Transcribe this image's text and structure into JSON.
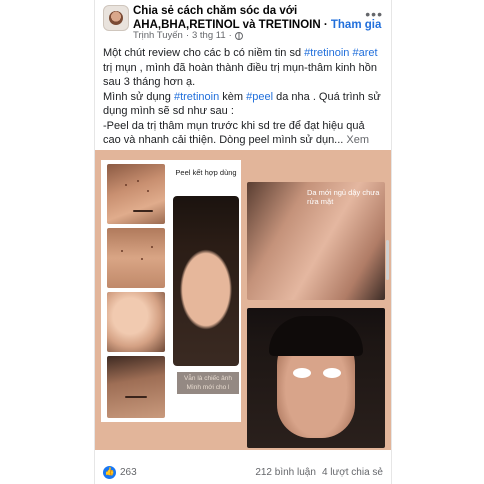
{
  "header": {
    "group_title": "Chia sẻ cách chăm sóc da với AHA,BHA,RETINOL và TRETINOIN",
    "separator": " · ",
    "join_label": "Tham gia",
    "author": "Trịnh Tuyến",
    "date": "3 thg 11",
    "more_icon": "more-options-icon",
    "privacy_icon": "globe-icon"
  },
  "post": {
    "line1_prefix": "Một chút review cho các b có niềm tin sd ",
    "tag_tretinoin": "#tretinoin",
    "tag_aret": "#aret",
    "line1_suffix": " trị mụn , mình đã hoàn thành điều trị mụn-thâm kinh hồn sau 3 tháng hơn ạ.",
    "line2_prefix": "Mình sử dụng ",
    "tag_tretinoin2": "#tretinoin",
    "line2_mid": " kèm ",
    "tag_peel": "#peel",
    "line2_suffix": " da nha . Quá trình sử dụng mình sẽ sd như sau :",
    "line3": "-Peel da trị thâm mụn trước khi sd tre để đạt hiệu quả cao và nhanh cải thiện. Dòng peel mình sử dụn...",
    "see_more": "Xem thêm"
  },
  "photos": {
    "peel_label": "Peel kết hợp dùng",
    "peel_caption_1": "Vẫn là chiếc ảnh",
    "peel_caption_2": "Mình mới cho l",
    "wake_label": "Da mới ngủ dậy chưa rửa mặt"
  },
  "footer": {
    "like_icon": "thumbs-up-icon",
    "reaction_count": "263",
    "comments": "212 bình luận",
    "shares": "4 lượt chia sẻ"
  },
  "colors": {
    "link_blue": "#216fdb",
    "photo_bg": "#e2b59a",
    "like_blue": "#1877f2"
  }
}
